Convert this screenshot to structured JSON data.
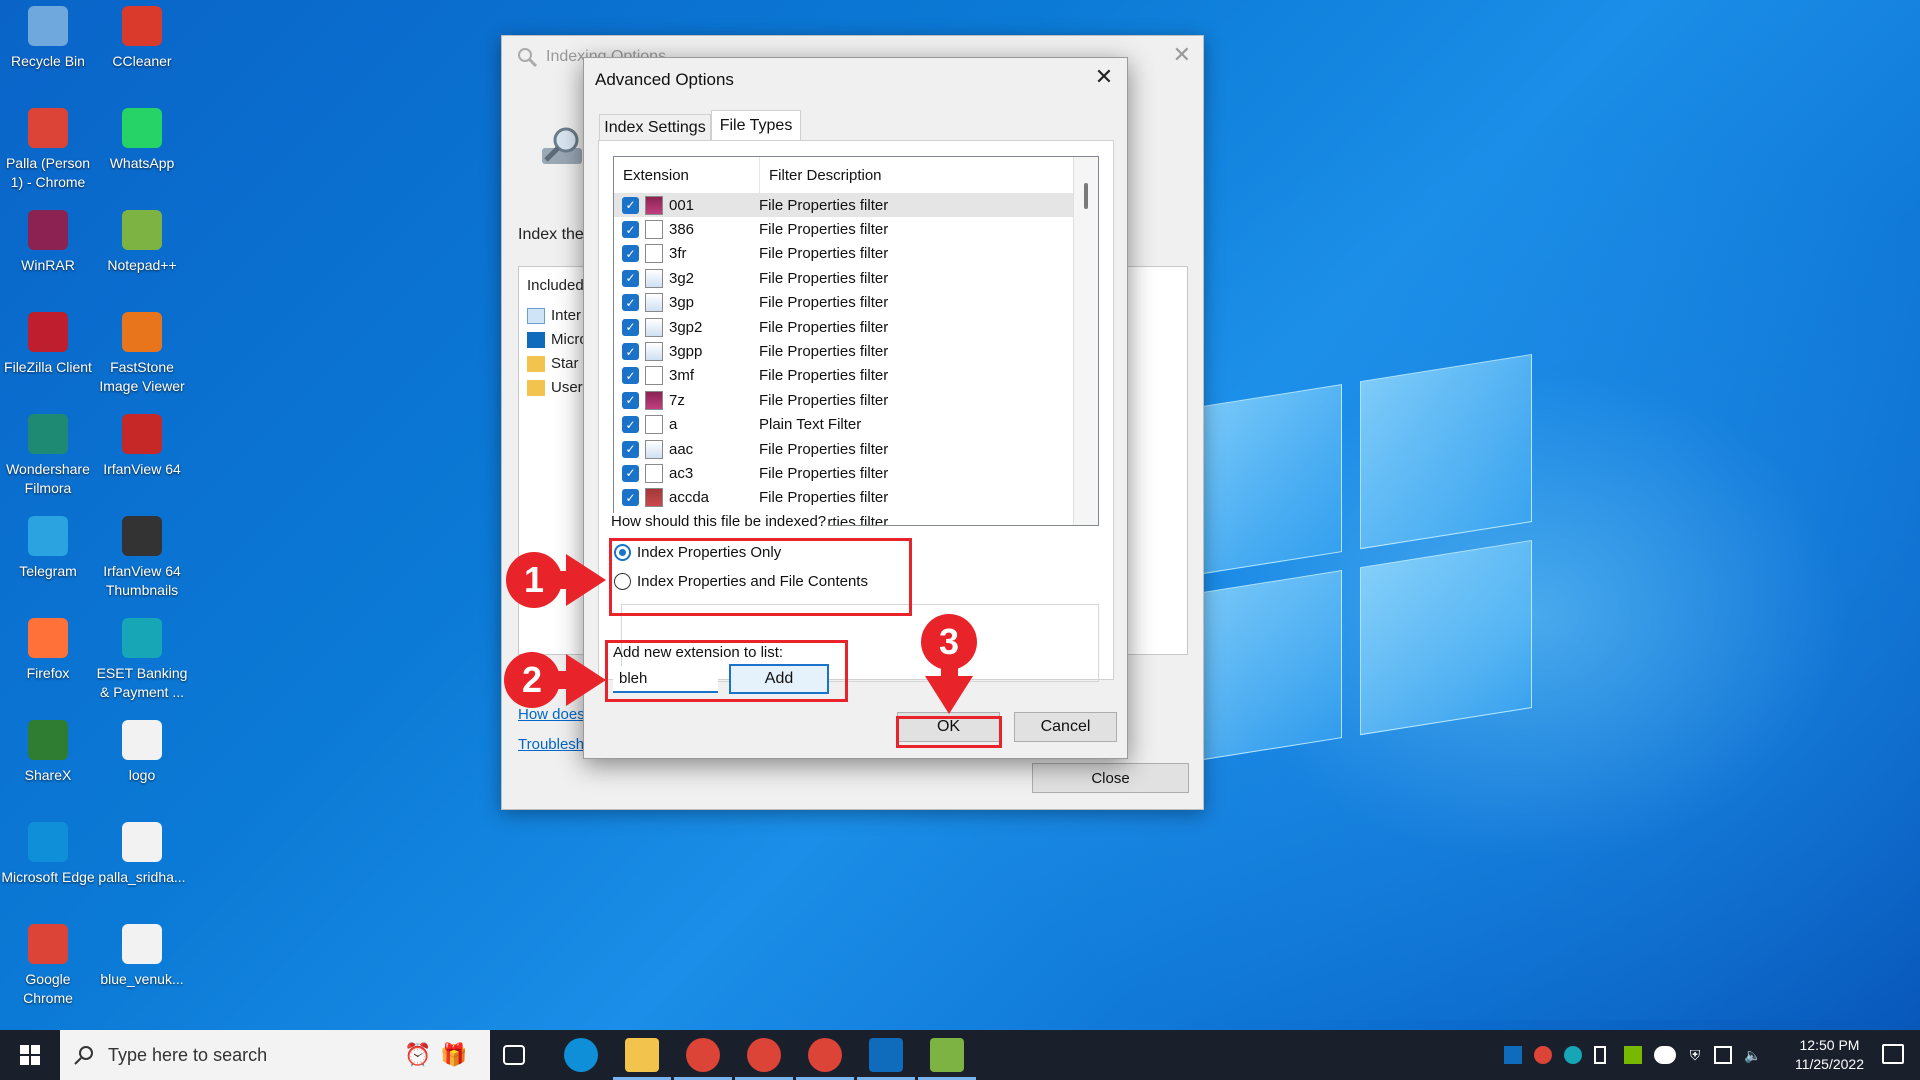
{
  "desktop_icons": [
    {
      "label": "Recycle Bin",
      "icon": "recycle-bin-icon",
      "color": "#6fa8dc"
    },
    {
      "label": "CCleaner",
      "icon": "ccleaner-icon",
      "color": "#d93a2b"
    },
    {
      "label": "Palla (Person 1) - Chrome",
      "icon": "chrome-icon",
      "color": "#db4437"
    },
    {
      "label": "WhatsApp",
      "icon": "whatsapp-icon",
      "color": "#25d366"
    },
    {
      "label": "WinRAR",
      "icon": "winrar-icon",
      "color": "#8b2252"
    },
    {
      "label": "Notepad++",
      "icon": "notepadpp-icon",
      "color": "#7cb342"
    },
    {
      "label": "FileZilla Client",
      "icon": "filezilla-icon",
      "color": "#bf1e2e"
    },
    {
      "label": "FastStone Image Viewer",
      "icon": "faststone-icon",
      "color": "#e8741b"
    },
    {
      "label": "Wondershare Filmora",
      "icon": "filmora-icon",
      "color": "#1e8a74"
    },
    {
      "label": "IrfanView 64",
      "icon": "irfanview-icon",
      "color": "#c62828"
    },
    {
      "label": "Telegram",
      "icon": "telegram-icon",
      "color": "#2aa3e0"
    },
    {
      "label": "IrfanView 64 Thumbnails",
      "icon": "irfanview-thumbnails-icon",
      "color": "#333333"
    },
    {
      "label": "Firefox",
      "icon": "firefox-icon",
      "color": "#ff7139"
    },
    {
      "label": "ESET Banking & Payment ...",
      "icon": "eset-icon",
      "color": "#16a6b6"
    },
    {
      "label": "ShareX",
      "icon": "sharex-icon",
      "color": "#2e7d32"
    },
    {
      "label": "logo",
      "icon": "png-file-icon",
      "color": "#f2f2f2"
    },
    {
      "label": "Microsoft Edge",
      "icon": "edge-icon",
      "color": "#0f8fd8"
    },
    {
      "label": "palla_sridha...",
      "icon": "png-file-icon",
      "color": "#f2f2f2"
    },
    {
      "label": "Google Chrome",
      "icon": "chrome-icon",
      "color": "#db4437"
    },
    {
      "label": "blue_venuk...",
      "icon": "jpg-file-icon",
      "color": "#f2f2f2"
    }
  ],
  "indexing_window": {
    "title": "Indexing Options",
    "index_label": "Index the",
    "panel_header": "Included",
    "rows": [
      "Inter",
      "Micro",
      "Star",
      "User"
    ],
    "link_how": "How does",
    "link_troubleshoot": "Troublesh",
    "close_label": "Close"
  },
  "advanced_dialog": {
    "title": "Advanced Options",
    "tabs": [
      {
        "label": "Index Settings",
        "active": false
      },
      {
        "label": "File Types",
        "active": true
      }
    ],
    "columns": {
      "extension": "Extension",
      "description": "Filter Description"
    },
    "file_types": [
      {
        "ext": "001",
        "desc": "File Properties filter",
        "icon": "winrar-file-icon",
        "selected": true
      },
      {
        "ext": "386",
        "desc": "File Properties filter",
        "icon": "system-file-icon"
      },
      {
        "ext": "3fr",
        "desc": "File Properties filter",
        "icon": "blank-file-icon"
      },
      {
        "ext": "3g2",
        "desc": "File Properties filter",
        "icon": "media-file-icon"
      },
      {
        "ext": "3gp",
        "desc": "File Properties filter",
        "icon": "media-file-icon"
      },
      {
        "ext": "3gp2",
        "desc": "File Properties filter",
        "icon": "media-file-icon"
      },
      {
        "ext": "3gpp",
        "desc": "File Properties filter",
        "icon": "media-file-icon"
      },
      {
        "ext": "3mf",
        "desc": "File Properties filter",
        "icon": "blank-file-icon"
      },
      {
        "ext": "7z",
        "desc": "File Properties filter",
        "icon": "winrar-file-icon"
      },
      {
        "ext": "a",
        "desc": "Plain Text Filter",
        "icon": "blank-file-icon"
      },
      {
        "ext": "aac",
        "desc": "File Properties filter",
        "icon": "media-file-icon"
      },
      {
        "ext": "ac3",
        "desc": "File Properties filter",
        "icon": "blank-file-icon"
      },
      {
        "ext": "accda",
        "desc": "File Properties filter",
        "icon": "access-file-icon"
      },
      {
        "ext": "accdb",
        "desc": "File Properties filter",
        "icon": "access-file-icon"
      }
    ],
    "index_question": "How should this file be indexed?",
    "radio_options": [
      {
        "label": "Index Properties Only",
        "checked": true
      },
      {
        "label": "Index Properties and File Contents",
        "checked": false
      }
    ],
    "add_extension_label": "Add new extension to list:",
    "add_extension_value": "bleh",
    "add_button": "Add",
    "ok_button": "OK",
    "cancel_button": "Cancel"
  },
  "annotations": {
    "step1": "1",
    "step2": "2",
    "step3": "3",
    "color": "#e8232a"
  },
  "taskbar": {
    "search_placeholder": "Type here to search",
    "pinned": [
      "task-view-icon",
      "edge-icon",
      "file-explorer-icon",
      "chrome-icon",
      "chrome-icon",
      "chrome-icon",
      "outlook-icon",
      "notepadpp-icon"
    ],
    "time": "12:50 PM",
    "date": "11/25/2022"
  }
}
